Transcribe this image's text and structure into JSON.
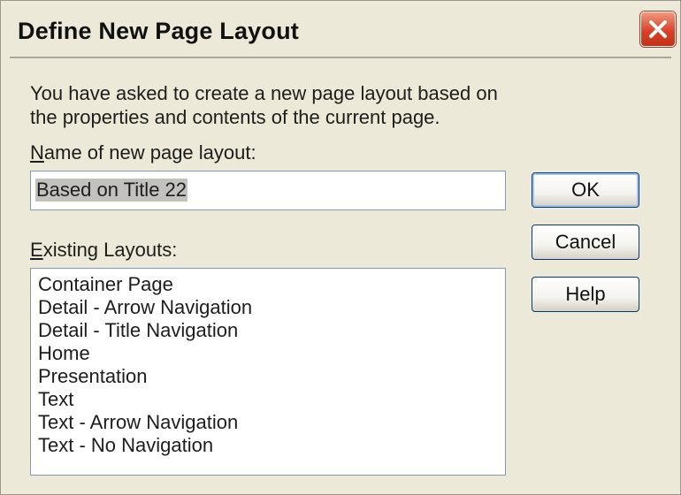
{
  "dialog": {
    "title": "Define New Page Layout",
    "description": "You have asked to create a new page layout based on the properties and contents of the current page.",
    "name_label_accesskey": "N",
    "name_label_rest": "ame of new page layout:",
    "name_value": "Based on Title 22",
    "existing_label_accesskey": "E",
    "existing_label_rest": "xisting Layouts:",
    "layouts": [
      "Container Page",
      "Detail - Arrow Navigation",
      "Detail - Title Navigation",
      "Home",
      "Presentation",
      "Text",
      "Text - Arrow Navigation",
      "Text - No Navigation"
    ],
    "buttons": {
      "ok": "OK",
      "cancel": "Cancel",
      "help": "Help"
    },
    "icons": {
      "close": "close-icon"
    },
    "colors": {
      "close_button": "#d8432a",
      "background": "#ece9d8"
    }
  }
}
